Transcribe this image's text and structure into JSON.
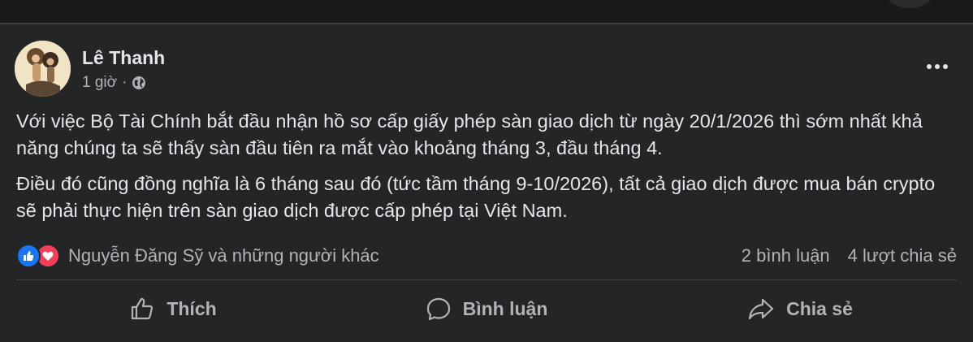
{
  "post": {
    "author": "Lê Thanh",
    "time": "1 giờ",
    "separator": "·",
    "privacy_icon": "globe-icon",
    "more_icon": "more-options-icon",
    "paragraphs": [
      "Với việc Bộ Tài Chính bắt đầu nhận hồ sơ cấp giấy phép sàn giao dịch từ ngày 20/1/2026 thì sớm nhất khả năng chúng ta sẽ thấy sàn đầu tiên ra mắt vào khoảng tháng 3, đầu tháng 4.",
      "Điều đó cũng đồng nghĩa là 6 tháng sau đó (tức tầm tháng 9-10/2026), tất cả giao dịch được mua bán crypto sẽ phải thực hiện trên sàn giao dịch được cấp phép tại Việt Nam."
    ]
  },
  "reactions": {
    "icons": [
      "like-reaction-icon",
      "love-reaction-icon"
    ],
    "summary": "Nguyễn Đăng Sỹ và những người khác",
    "comments": "2 bình luận",
    "shares": "4 lượt chia sẻ"
  },
  "actions": {
    "like": "Thích",
    "comment": "Bình luận",
    "share": "Chia sẻ"
  },
  "colors": {
    "background": "#242526",
    "text": "#e4e6eb",
    "secondary_text": "#b0b3b8",
    "like_blue": "#1877f2",
    "love_red": "#f33e58"
  }
}
